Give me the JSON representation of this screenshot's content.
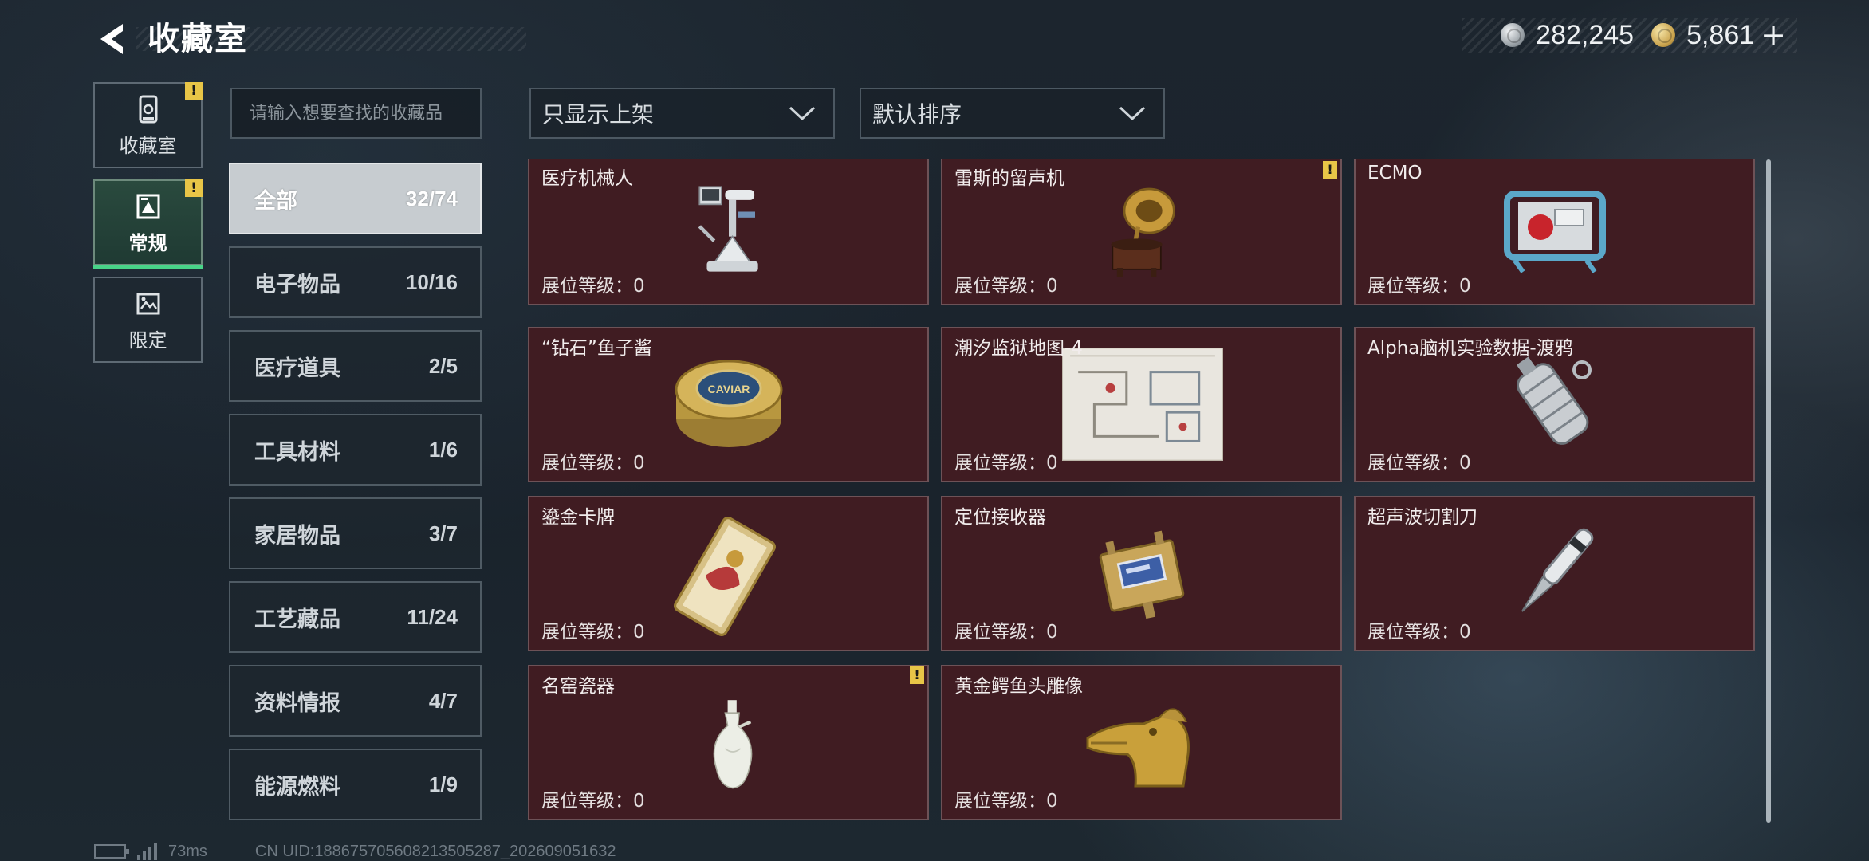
{
  "header": {
    "title": "收藏室",
    "currency": [
      {
        "icon": "silver-coin-icon",
        "value": "282,245"
      },
      {
        "icon": "gold-coin-icon",
        "value": "5,861"
      }
    ],
    "plus_label": "+"
  },
  "nav": {
    "items": [
      {
        "label": "收藏室",
        "icon": "collection-room-icon",
        "badge": "!"
      },
      {
        "label": "常规",
        "icon": "regular-icon",
        "badge": "!",
        "active": true
      },
      {
        "label": "限定",
        "icon": "limited-icon"
      }
    ]
  },
  "search": {
    "placeholder": "请输入想要查找的收藏品"
  },
  "categories": [
    {
      "name": "全部",
      "count": "32/74",
      "active": true
    },
    {
      "name": "电子物品",
      "count": "10/16"
    },
    {
      "name": "医疗道具",
      "count": "2/5"
    },
    {
      "name": "工具材料",
      "count": "1/6"
    },
    {
      "name": "家居物品",
      "count": "3/7"
    },
    {
      "name": "工艺藏品",
      "count": "11/24"
    },
    {
      "name": "资料情报",
      "count": "4/7"
    },
    {
      "name": "能源燃料",
      "count": "1/9"
    }
  ],
  "filters": {
    "display": "只显示上架",
    "sort": "默认排序"
  },
  "items": [
    {
      "name": "医疗机械人",
      "level": "展位等级：0",
      "art": "medical-robot"
    },
    {
      "name": "雷斯的留声机",
      "level": "展位等级：0",
      "art": "gramophone",
      "badge": "!"
    },
    {
      "name": "ECMO",
      "level": "展位等级：0",
      "art": "ecmo"
    },
    {
      "name": "“钻石”鱼子酱",
      "level": "展位等级：0",
      "art": "caviar",
      "art_text": "CAVIAR"
    },
    {
      "name": "潮汐监狱地图-4",
      "level": "展位等级：0",
      "art": "map"
    },
    {
      "name": "Alpha脑机实验数据-渡鸦",
      "level": "展位等级：0",
      "art": "data-drive"
    },
    {
      "name": "鎏金卡牌",
      "level": "展位等级：0",
      "art": "gilded-card"
    },
    {
      "name": "定位接收器",
      "level": "展位等级：0",
      "art": "receiver"
    },
    {
      "name": "超声波切割刀",
      "level": "展位等级：0",
      "art": "ultrasonic-knife"
    },
    {
      "name": "名窑瓷器",
      "level": "展位等级：0",
      "art": "porcelain-vase",
      "badge": "!"
    },
    {
      "name": "黄金鳄鱼头雕像",
      "level": "展位等级：0",
      "art": "gold-croc-statue"
    }
  ],
  "footer": {
    "ping": "73ms",
    "uid": "CN UID:18867570560821350528​7_202609051632"
  },
  "colors": {
    "card_bg": "#401c22",
    "active_green": "#48d488",
    "badge_yellow": "#e8c547"
  }
}
